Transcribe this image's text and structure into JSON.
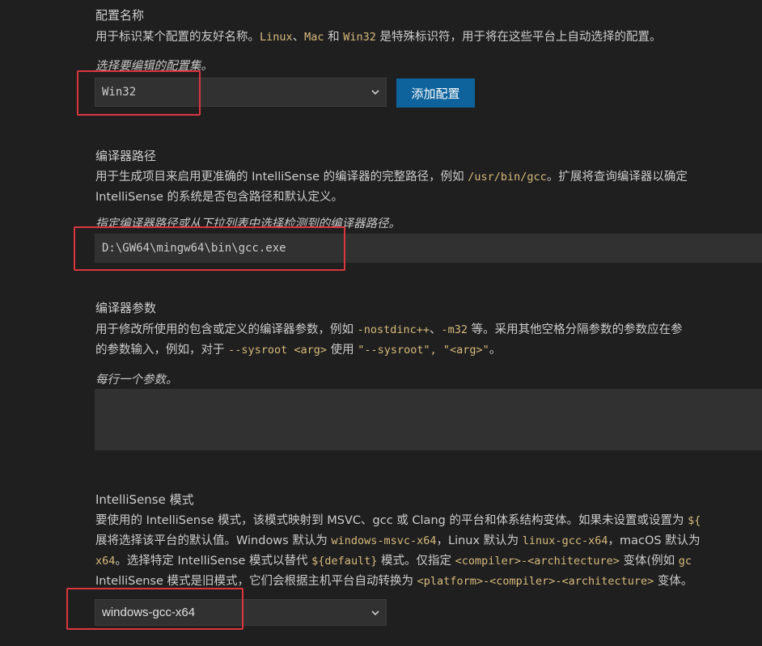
{
  "config_name": {
    "heading": "配置名称",
    "desc_parts": [
      "用于标识某个配置的友好名称。",
      "Linux",
      "、",
      "Mac",
      " 和 ",
      "Win32",
      " 是特殊标识符，用于将在这些平台上自动选择的配置。"
    ],
    "hint": "选择要编辑的配置集。",
    "selected": "Win32",
    "add_button": "添加配置"
  },
  "compiler_path": {
    "heading": "编译器路径",
    "line1_parts": [
      "用于生成项目来启用更准确的 IntelliSense 的编译器的完整路径，例如 ",
      "/usr/bin/gcc",
      "。扩展将查询编译器以确定"
    ],
    "line2": "IntelliSense 的系统是否包含路径和默认定义。",
    "hint": "指定编译器路径或从下拉列表中选择检测到的编译器路径。",
    "value": "D:\\GW64\\mingw64\\bin\\gcc.exe"
  },
  "compiler_args": {
    "heading": "编译器参数",
    "line1_parts": [
      "用于修改所使用的包含或定义的编译器参数，例如 ",
      "-nostdinc++",
      "、",
      "-m32",
      " 等。采用其他空格分隔参数的参数应在参"
    ],
    "line2_parts": [
      "的参数输入，例如，对于 ",
      "--sysroot <arg>",
      " 使用 ",
      "\"--sysroot\", \"<arg>\"",
      "。"
    ],
    "hint": "每行一个参数。"
  },
  "intellisense_mode": {
    "heading": "IntelliSense 模式",
    "line1_parts": [
      "要使用的 IntelliSense 模式，该模式映射到 MSVC、gcc 或 Clang 的平台和体系结构变体。如果未设置或设置为 ",
      "${"
    ],
    "line2_parts": [
      "展将选择该平台的默认值。Windows 默认为 ",
      "windows-msvc-x64",
      "，Linux 默认为 ",
      "linux-gcc-x64",
      "，macOS 默认为"
    ],
    "line3_parts": [
      "x64",
      "。选择特定 IntelliSense 模式以替代 ",
      "${default}",
      " 模式。仅指定 ",
      "<compiler>-<architecture>",
      " 变体(例如 ",
      "gc"
    ],
    "line4_parts": [
      "IntelliSense 模式是旧模式，它们会根据主机平台自动转换为 ",
      "<platform>-<compiler>-<architecture>",
      " 变体。"
    ],
    "selected": "windows-gcc-x64"
  },
  "colors": {
    "background": "#1f1f1f",
    "accent": "#0e639c",
    "code": "#d7ba7d",
    "highlight": "#d9363e"
  }
}
